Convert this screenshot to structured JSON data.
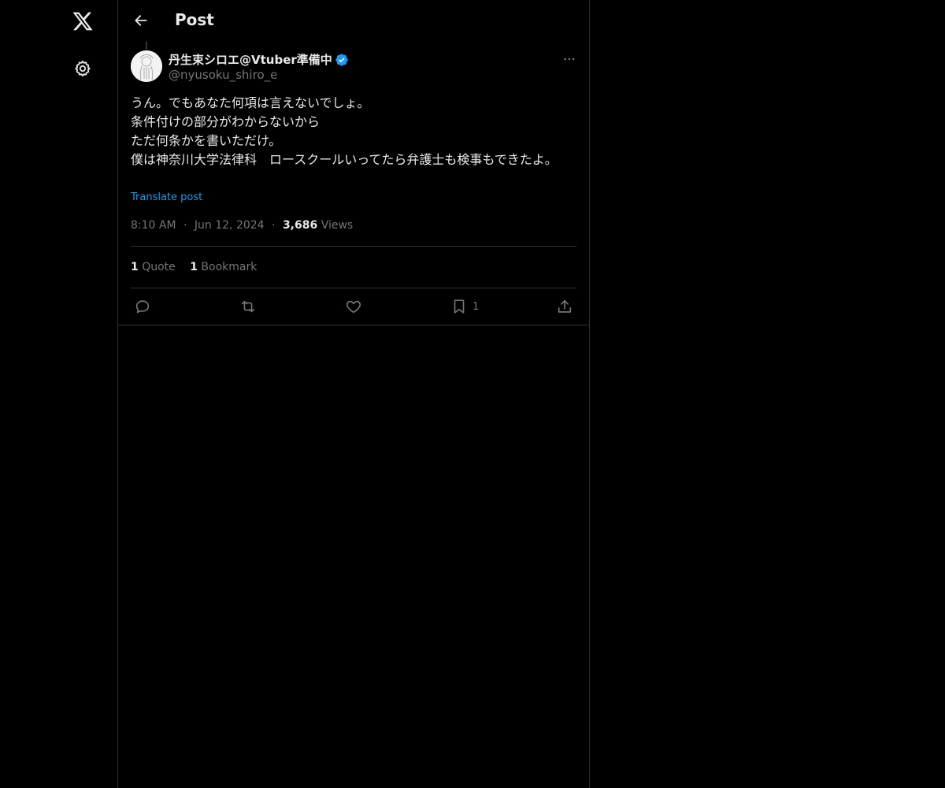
{
  "nav": {
    "logo_icon": "x-logo-icon",
    "settings_icon": "gear-icon"
  },
  "header": {
    "title": "Post"
  },
  "tweet": {
    "author_name": "丹生束シロエ@Vtuber準備中",
    "author_handle": "@nyusoku_shiro_e",
    "verified": true,
    "body": "うん。でもあなた何項は言えないでしょ。\n条件付けの部分がわからないから\nただ何条かを書いただけ。\n僕は神奈川大学法律科　ロースクールいってたら弁護士も検事もできたよ。",
    "translate_label": "Translate post",
    "time": "8:10 AM",
    "date": "Jun 12, 2024",
    "dot": "·",
    "views_count": "3,686",
    "views_label": "Views"
  },
  "stats": {
    "quotes_count": "1",
    "quotes_label": "Quote",
    "bookmarks_count": "1",
    "bookmarks_label": "Bookmark"
  },
  "actions": {
    "bookmark_count": "1"
  },
  "colors": {
    "background": "#000000",
    "text": "#e7e9ea",
    "secondary": "#71767b",
    "accent": "#1d9bf0",
    "border": "#2f3336"
  }
}
